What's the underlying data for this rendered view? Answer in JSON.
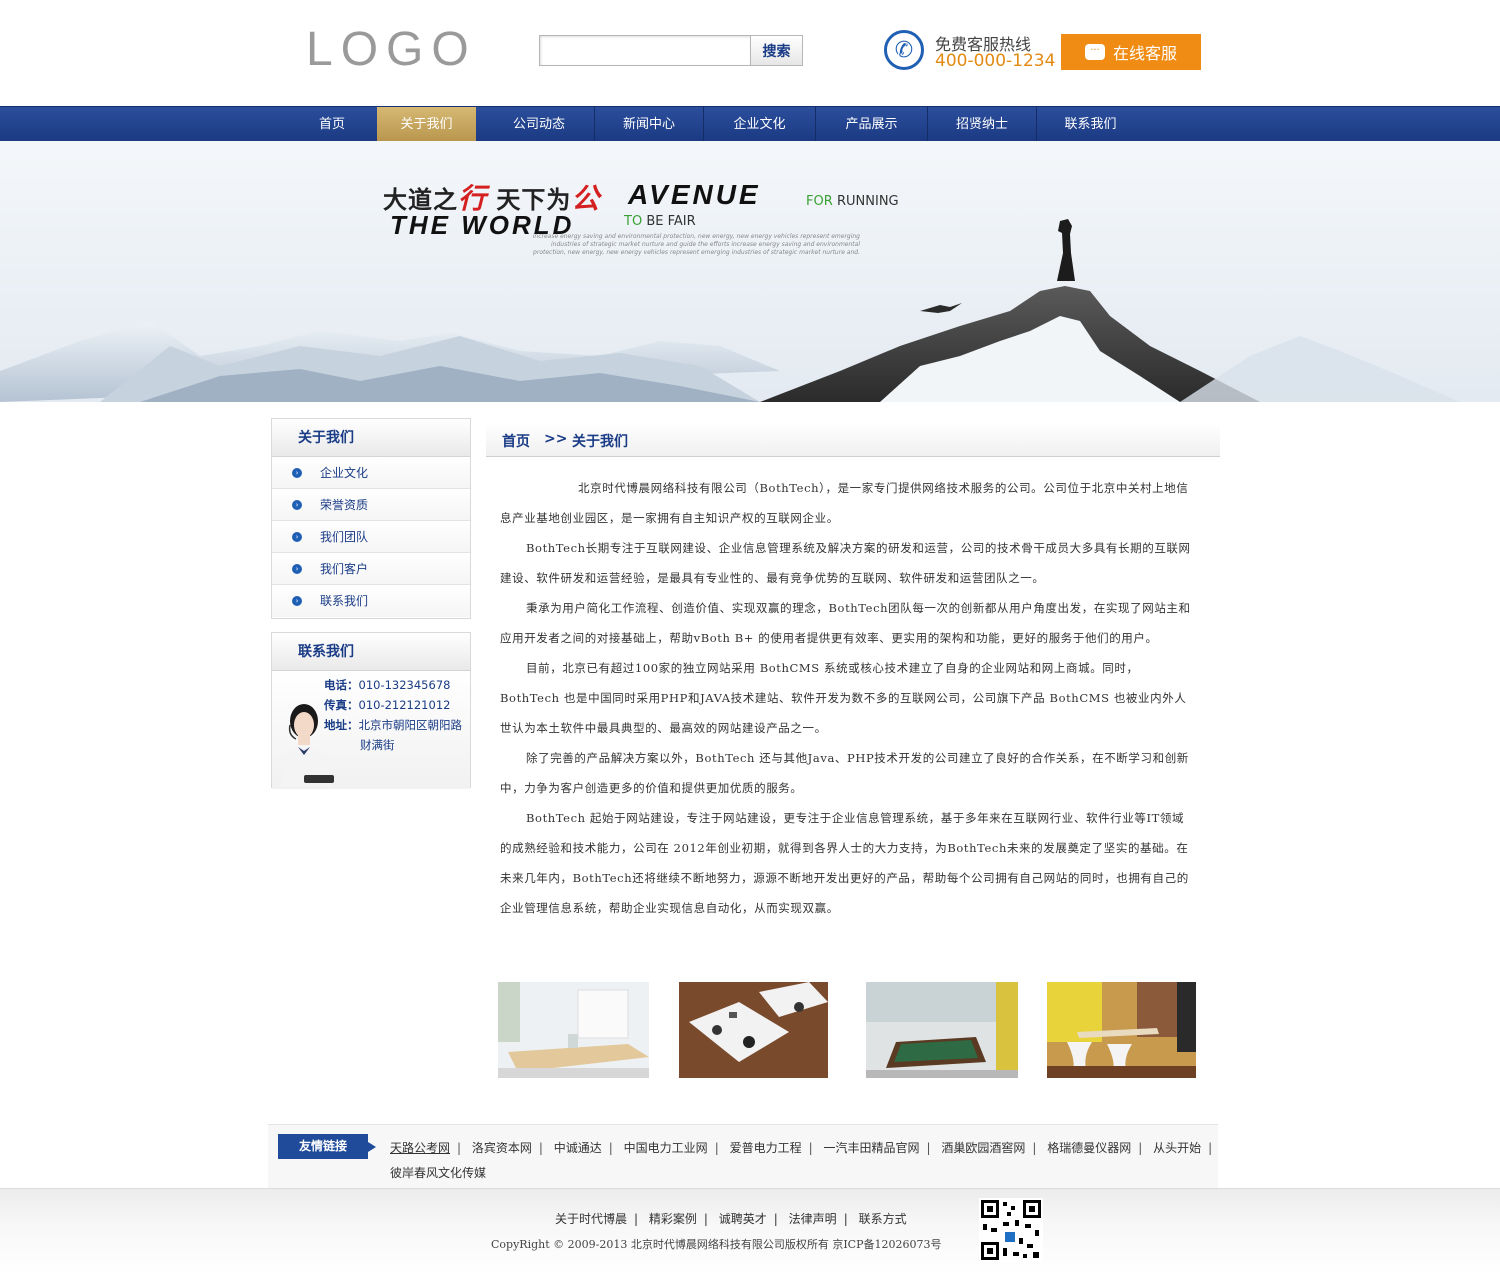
{
  "header": {
    "logo": "LOGO",
    "search": {
      "placeholder": "",
      "value": "",
      "button": "搜索"
    },
    "hotline_label": "免费客服热线",
    "hotline_number": "400-000-1234",
    "online_service": "在线客服"
  },
  "nav": {
    "items": [
      "首页",
      "关于我们",
      "公司动态",
      "新闻中心",
      "企业文化",
      "产品展示",
      "招贤纳士",
      "联系我们"
    ],
    "active": "关于我们"
  },
  "banner": {
    "cn_part1": "大道之",
    "cn_red1": "行",
    "cn_part2": " 天下为",
    "cn_red2": "公",
    "en_line1": "AVENUE",
    "en_for": "FOR",
    "en_running": "RUNNING",
    "en_line2": "THE WORLD",
    "en_to": "TO",
    "en_be_fair": "BE FAIR",
    "small_text": "increase energy saving and environmental protection, new energy, new energy vehicles represent emerging industries of strategic market nurture and guide the efforts increase energy saving and environmental protection, new energy, new energy vehicles represent emerging industries of strategic market nurture and."
  },
  "sidebar": {
    "about_title": "关于我们",
    "about_items": [
      "企业文化",
      "荣誉资质",
      "我们团队",
      "我们客户",
      "联系我们"
    ],
    "contact_title": "联系我们",
    "phone_label": "电话：",
    "phone": "010-132345678",
    "fax_label": "传真：",
    "fax": "010-212121012",
    "address_label": "地址：",
    "address_line1": "北京市朝阳区朝阳路",
    "address_line2": "财满街"
  },
  "breadcrumb": {
    "home": "首页",
    "separator": ">>",
    "current": "关于我们"
  },
  "article": {
    "paragraphs": [
      "北京时代博晨网络科技有限公司（BothTech），是一家专门提供网络技术服务的公司。公司位于北京中关村上地信息产业基地创业园区，是一家拥有自主知识产权的互联网企业。",
      "BothTech长期专注于互联网建设、企业信息管理系统及解决方案的研发和运营，公司的技术骨干成员大多具有长期的互联网建设、软件研发和运营经验，是最具有专业性的、最有竞争优势的互联网、软件研发和运营团队之一。",
      "秉承为用户简化工作流程、创造价值、实现双赢的理念，BothTech团队每一次的创新都从用户角度出发，在实现了网站主和应用开发者之间的对接基础上，帮助vBoth B+ 的使用者提供更有效率、更实用的架构和功能，更好的服务于他们的用户。",
      "目前，北京已有超过100家的独立网站采用 BothCMS 系统或核心技术建立了自身的企业网站和网上商城。同时，BothTech 也是中国同时采用PHP和JAVA技术建站、软件开发为数不多的互联网公司，公司旗下产品 BothCMS 也被业内外人世认为本土软件中最具典型的、最高效的网站建设产品之一。",
      "除了完善的产品解决方案以外，BothTech 还与其他Java、PHP技术开发的公司建立了良好的合作关系，在不断学习和创新中，力争为客户创造更多的价值和提供更加优质的服务。",
      "BothTech 起始于网站建设，专注于网站建设，更专注于企业信息管理系统，基于多年来在互联网行业、软件行业等IT领域的成熟经验和技术能力，公司在 2012年创业初期，就得到各界人士的大力支持，为BothTech未来的发展奠定了坚实的基础。在未来几年内，BothTech还将继续不断地努力，源源不断地开发出更好的产品，帮助每个公司拥有自己网站的同时，也拥有自己的企业管理信息系统，帮助企业实现信息自动化，从而实现双赢。"
    ]
  },
  "links": {
    "tag": "友情链接",
    "row1": [
      "天路公考网",
      "洛宾资本网",
      "中诚通达",
      "中国电力工业网",
      "爱普电力工程",
      "一汽丰田精品官网",
      "酒巢欧园酒窖网",
      "格瑞德曼仪器网",
      "从头开始"
    ],
    "row2": [
      "彼岸春风文化传媒"
    ]
  },
  "footer": {
    "links": [
      "关于时代博晨",
      "精彩案例",
      "诚聘英才",
      "法律声明",
      "联系方式"
    ],
    "copyright": "CopyRight © 2009-2013  北京时代博晨网络科技有限公司版权所有  京ICP备12026073号"
  },
  "colors": {
    "nav": "#1c3a83",
    "nav_active": "#c4a35e",
    "accent_orange": "#f08c14",
    "link_blue": "#1a3c86"
  }
}
